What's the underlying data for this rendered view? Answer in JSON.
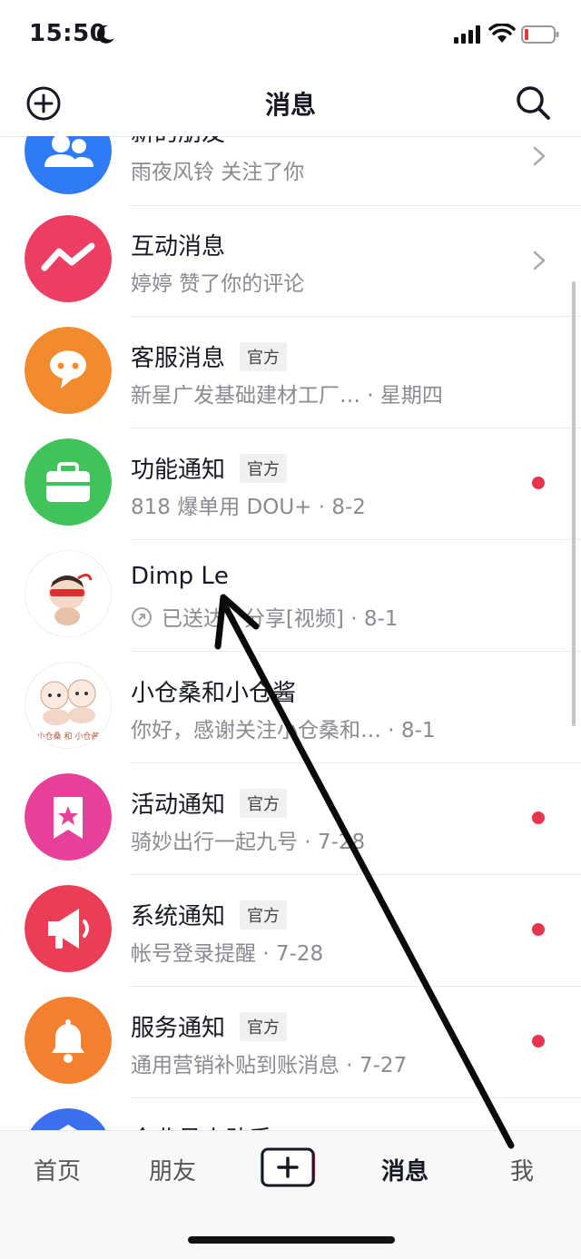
{
  "status_bar": {
    "time": "15:50"
  },
  "nav": {
    "title": "消息"
  },
  "messages": [
    {
      "title": "新的朋友",
      "subtitle": "雨夜风铃 关注了你",
      "icon": "people-icon",
      "color": "#2f7bf5"
    },
    {
      "title": "互动消息",
      "subtitle": "婷婷 赞了你的评论",
      "icon": "zigzag-icon",
      "color": "#ec3d62"
    },
    {
      "title": "客服消息",
      "badge": "官方",
      "subtitle": "新星广发基础建材工厂… · 星期四",
      "icon": "chat-bubble-icon",
      "color": "#f28a2e"
    },
    {
      "title": "功能通知",
      "badge": "官方",
      "subtitle": "818 爆单用 DOU+ · 8-2",
      "icon": "briefcase-icon",
      "color": "#3fc35a"
    },
    {
      "title": "Dimp ᒪe",
      "subtitle": "已送达 · 分享[视频] · 8-1",
      "icon": "cartoon-baby-avatar",
      "color": "#ffffff"
    },
    {
      "title": "小仓桑和小仓酱",
      "subtitle": "你好，感谢关注小仓桑和… · 8-1",
      "icon": "cartoon-couple-avatar",
      "color": "#ffffff",
      "avatar_text": "小仓桑 和 小仓酱"
    },
    {
      "title": "活动通知",
      "badge": "官方",
      "subtitle": "骑妙出行一起九号 · 7-28",
      "icon": "bookmark-star-icon",
      "color": "#e6409a"
    },
    {
      "title": "系统通知",
      "badge": "官方",
      "subtitle": "帐号登录提醒 · 7-28",
      "icon": "megaphone-icon",
      "color": "#ec3d57"
    },
    {
      "title": "服务通知",
      "badge": "官方",
      "subtitle": "通用营销补贴到账消息 · 7-27",
      "icon": "bell-icon",
      "color": "#f2802e"
    },
    {
      "title": "企业号小助手",
      "icon": "enterprise-icon",
      "color": "#3b6ff0"
    }
  ],
  "tabbar": {
    "home": "首页",
    "friends": "朋友",
    "messages": "消息",
    "me": "我"
  }
}
